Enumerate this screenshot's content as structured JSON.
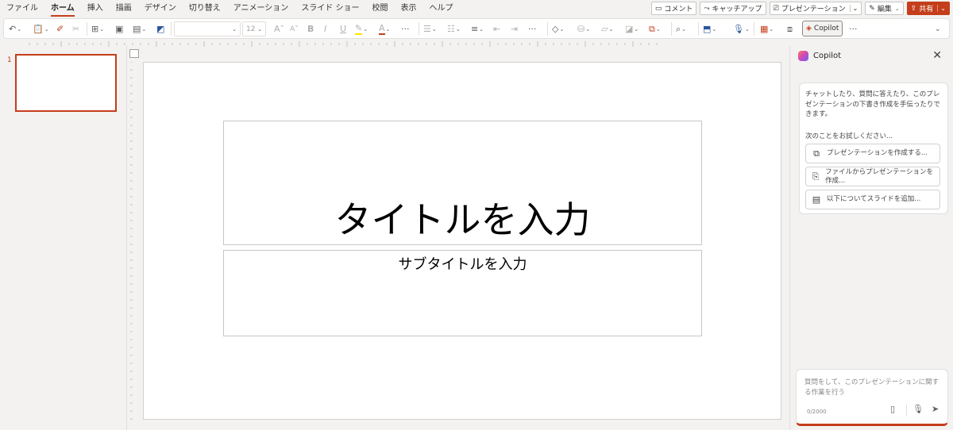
{
  "menu": {
    "tabs": [
      "ファイル",
      "ホーム",
      "挿入",
      "描画",
      "デザイン",
      "切り替え",
      "アニメーション",
      "スライド ショー",
      "校閲",
      "表示",
      "ヘルプ"
    ],
    "active_tab": "ホーム",
    "comment_label": "コメント",
    "catchup_label": "キャッチアップ",
    "present_label": "プレゼンテーション",
    "edit_label": "編集",
    "share_label": "共有"
  },
  "ribbon": {
    "font_name": "",
    "font_size": "12",
    "copilot_label": "Copilot",
    "more_label": "···"
  },
  "thumbnails": {
    "slide_number": "1"
  },
  "slide": {
    "title_placeholder": "タイトルを入力",
    "subtitle_placeholder": "サブタイトルを入力"
  },
  "copilot": {
    "title": "Copilot",
    "close": "✕",
    "intro": "チャットしたり、質問に答えたり、このプレゼンテーションの下書き作成を手伝ったりできます。",
    "try_label": "次のことをお試しください...",
    "suggestions": [
      {
        "label": "プレゼンテーションを作成する...",
        "icon": "slides-icon"
      },
      {
        "label": "ファイルからプレゼンテーションを作成...",
        "icon": "file-search-icon"
      },
      {
        "label": "以下についてスライドを追加...",
        "icon": "add-slide-icon"
      }
    ],
    "input_placeholder": "質問をして、このプレゼンテーションに関する作業を行う",
    "char_count": "0/2000"
  },
  "colors": {
    "accent": "#c43e1c",
    "background": "#f3f2f1"
  }
}
